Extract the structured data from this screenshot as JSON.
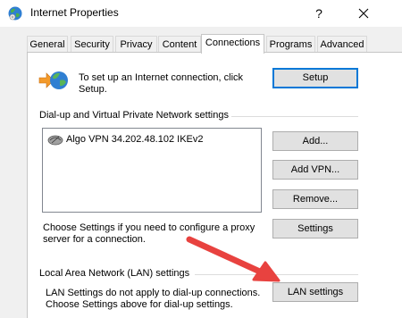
{
  "window": {
    "title": "Internet Properties",
    "help_glyph": "?",
    "close_icon": "close-icon"
  },
  "tabs": [
    {
      "label": "General",
      "active": false
    },
    {
      "label": "Security",
      "active": false
    },
    {
      "label": "Privacy",
      "active": false
    },
    {
      "label": "Content",
      "active": false
    },
    {
      "label": "Connections",
      "active": true
    },
    {
      "label": "Programs",
      "active": false
    },
    {
      "label": "Advanced",
      "active": false
    }
  ],
  "setup": {
    "text_line1": "To set up an Internet connection, click",
    "text_line2": "Setup.",
    "button_label": "Setup"
  },
  "vpn_section": {
    "heading": "Dial-up and Virtual Private Network settings",
    "items": [
      {
        "label": "Algo VPN 34.202.48.102 IKEv2",
        "icon": "network-connection-icon"
      }
    ],
    "add_label": "Add...",
    "add_vpn_label": "Add VPN...",
    "remove_label": "Remove...",
    "settings_label": "Settings",
    "proxy_text_line1": "Choose Settings if you need to configure a proxy",
    "proxy_text_line2": "server for a connection."
  },
  "lan_section": {
    "heading": "Local Area Network (LAN) settings",
    "text_line1": "LAN Settings do not apply to dial-up connections.",
    "text_line2": "Choose Settings above for dial-up settings.",
    "button_label": "LAN settings"
  },
  "annotation": {
    "arrow_color": "#e8423f"
  },
  "colors": {
    "accent_border": "#0078d7",
    "button_face": "#e1e1e1"
  }
}
